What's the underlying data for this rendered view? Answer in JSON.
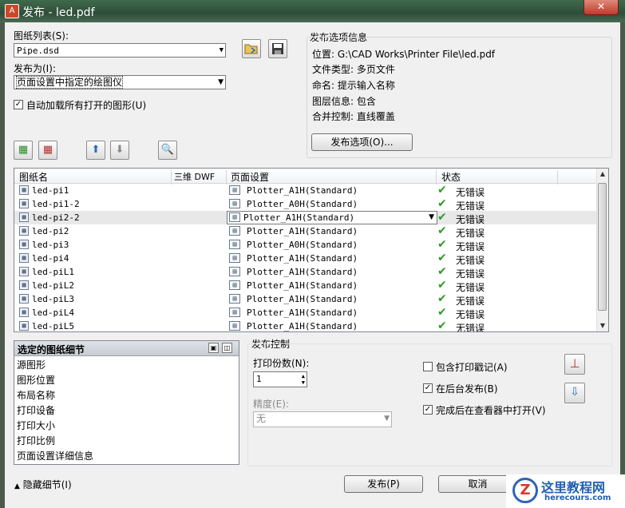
{
  "window": {
    "title": "发布 - led.pdf",
    "close": "✕"
  },
  "sheet_list": {
    "label": "图纸列表(S):",
    "value": "Pipe.dsd",
    "open_tooltip": "",
    "save_tooltip": ""
  },
  "publish_to": {
    "label": "发布为(I):",
    "value": "页面设置中指定的绘图仪"
  },
  "auto_load": {
    "label": "自动加载所有打开的图形(U)",
    "checked": true
  },
  "info": {
    "title": "发布选项信息",
    "location": "位置: G:\\CAD Works\\Printer File\\led.pdf",
    "filetype": "文件类型: 多页文件",
    "naming": "命名: 提示输入名称",
    "layers": "图层信息: 包含",
    "merge": "合并控制: 直线覆盖",
    "options_button": "发布选项(O)..."
  },
  "table": {
    "columns": [
      "图纸名",
      "三维 DWF",
      "页面设置",
      "状态"
    ],
    "rows": [
      {
        "name": "led-pi1",
        "setup": "Plotter_A1H(Standard)",
        "status": "无错误"
      },
      {
        "name": "led-pi1-2",
        "setup": "Plotter_A0H(Standard)",
        "status": "无错误"
      },
      {
        "name": "led-pi2-2",
        "setup": "Plotter_A1H(Standard)",
        "status": "无错误"
      },
      {
        "name": "led-pi2",
        "setup": "Plotter_A1H(Standard)",
        "status": "无错误"
      },
      {
        "name": "led-pi3",
        "setup": "Plotter_A0H(Standard)",
        "status": "无错误"
      },
      {
        "name": "led-pi4",
        "setup": "Plotter_A1H(Standard)",
        "status": "无错误"
      },
      {
        "name": "led-piL1",
        "setup": "Plotter_A1H(Standard)",
        "status": "无错误"
      },
      {
        "name": "led-piL2",
        "setup": "Plotter_A1H(Standard)",
        "status": "无错误"
      },
      {
        "name": "led-piL3",
        "setup": "Plotter_A1H(Standard)",
        "status": "无错误"
      },
      {
        "name": "led-piL4",
        "setup": "Plotter_A1H(Standard)",
        "status": "无错误"
      },
      {
        "name": "led-piL5",
        "setup": "Plotter_A1H(Standard)",
        "status": "无错误"
      }
    ]
  },
  "details": {
    "title": "选定的图纸细节",
    "items": [
      "源图形",
      "图形位置",
      "布局名称",
      "打印设备",
      "打印大小",
      "打印比例",
      "页面设置详细信息"
    ]
  },
  "publish_control": {
    "title": "发布控制",
    "copies_label": "打印份数(N):",
    "copies_value": "1",
    "precision_label": "精度(E):",
    "precision_value": "无",
    "include_stamp": {
      "label": "包含打印戳记(A)",
      "checked": false
    },
    "background": {
      "label": "在后台发布(B)",
      "checked": true
    },
    "open_viewer": {
      "label": "完成后在查看器中打开(V)",
      "checked": true
    }
  },
  "footer": {
    "hide_details": "隐藏细节(I)",
    "publish": "发布(P)",
    "cancel": "取消"
  },
  "watermark": {
    "logo": "Z",
    "name": "这里教程网",
    "url": "herecours.com"
  }
}
